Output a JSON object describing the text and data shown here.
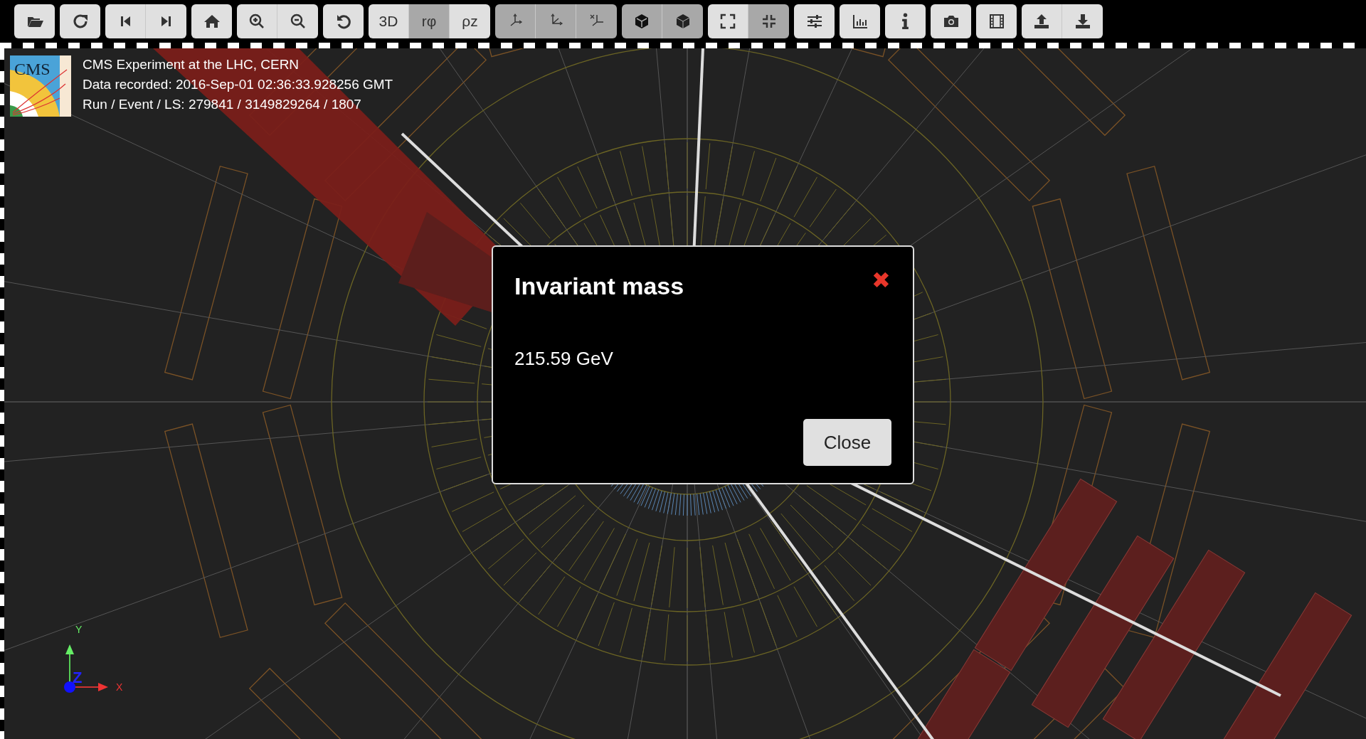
{
  "toolbar": {
    "groups": [
      {
        "buttons": [
          {
            "kind": "folder",
            "selected": false
          }
        ]
      },
      {
        "buttons": [
          {
            "kind": "reload",
            "selected": false
          }
        ]
      },
      {
        "buttons": [
          {
            "kind": "step-back",
            "selected": false
          },
          {
            "kind": "step-forward",
            "selected": false
          }
        ]
      },
      {
        "buttons": [
          {
            "kind": "home",
            "selected": false
          }
        ]
      },
      {
        "buttons": [
          {
            "kind": "zoom-in",
            "selected": false
          },
          {
            "kind": "zoom-out",
            "selected": false
          }
        ]
      },
      {
        "buttons": [
          {
            "kind": "undo",
            "selected": false
          }
        ]
      },
      {
        "buttons": [
          {
            "kind": "text",
            "label": "3D",
            "selected": false
          },
          {
            "kind": "text",
            "label": "rφ",
            "selected": true
          },
          {
            "kind": "text",
            "label": "ρz",
            "selected": false
          }
        ]
      },
      {
        "buttons": [
          {
            "kind": "axes-yzx",
            "selected": true
          },
          {
            "kind": "axes-yxz",
            "selected": true
          },
          {
            "kind": "axes-xyz",
            "selected": true
          }
        ]
      },
      {
        "buttons": [
          {
            "kind": "cube-dark",
            "selected": true
          },
          {
            "kind": "cube-light",
            "selected": true
          }
        ]
      },
      {
        "buttons": [
          {
            "kind": "expand",
            "selected": false
          },
          {
            "kind": "compress",
            "selected": true
          }
        ]
      },
      {
        "buttons": [
          {
            "kind": "sliders",
            "selected": false
          }
        ]
      },
      {
        "buttons": [
          {
            "kind": "chart",
            "selected": false
          }
        ]
      },
      {
        "buttons": [
          {
            "kind": "info",
            "selected": false
          }
        ]
      },
      {
        "buttons": [
          {
            "kind": "camera",
            "selected": false
          }
        ]
      },
      {
        "buttons": [
          {
            "kind": "film",
            "selected": false
          }
        ]
      },
      {
        "buttons": [
          {
            "kind": "upload",
            "selected": false
          },
          {
            "kind": "download",
            "selected": false
          }
        ]
      }
    ]
  },
  "event_info": {
    "logo_text": "CMS",
    "lines": [
      "CMS Experiment at the LHC, CERN",
      "Data recorded: 2016-Sep-01 02:36:33.928256 GMT",
      "Run / Event / LS: 279841 / 3149829264 / 1807"
    ]
  },
  "axes_widget": {
    "x": "X",
    "y": "Y",
    "z": "Z"
  },
  "dialog": {
    "title": "Invariant mass",
    "close_icon": "✖",
    "value": "215.59 GeV",
    "button": "Close"
  }
}
